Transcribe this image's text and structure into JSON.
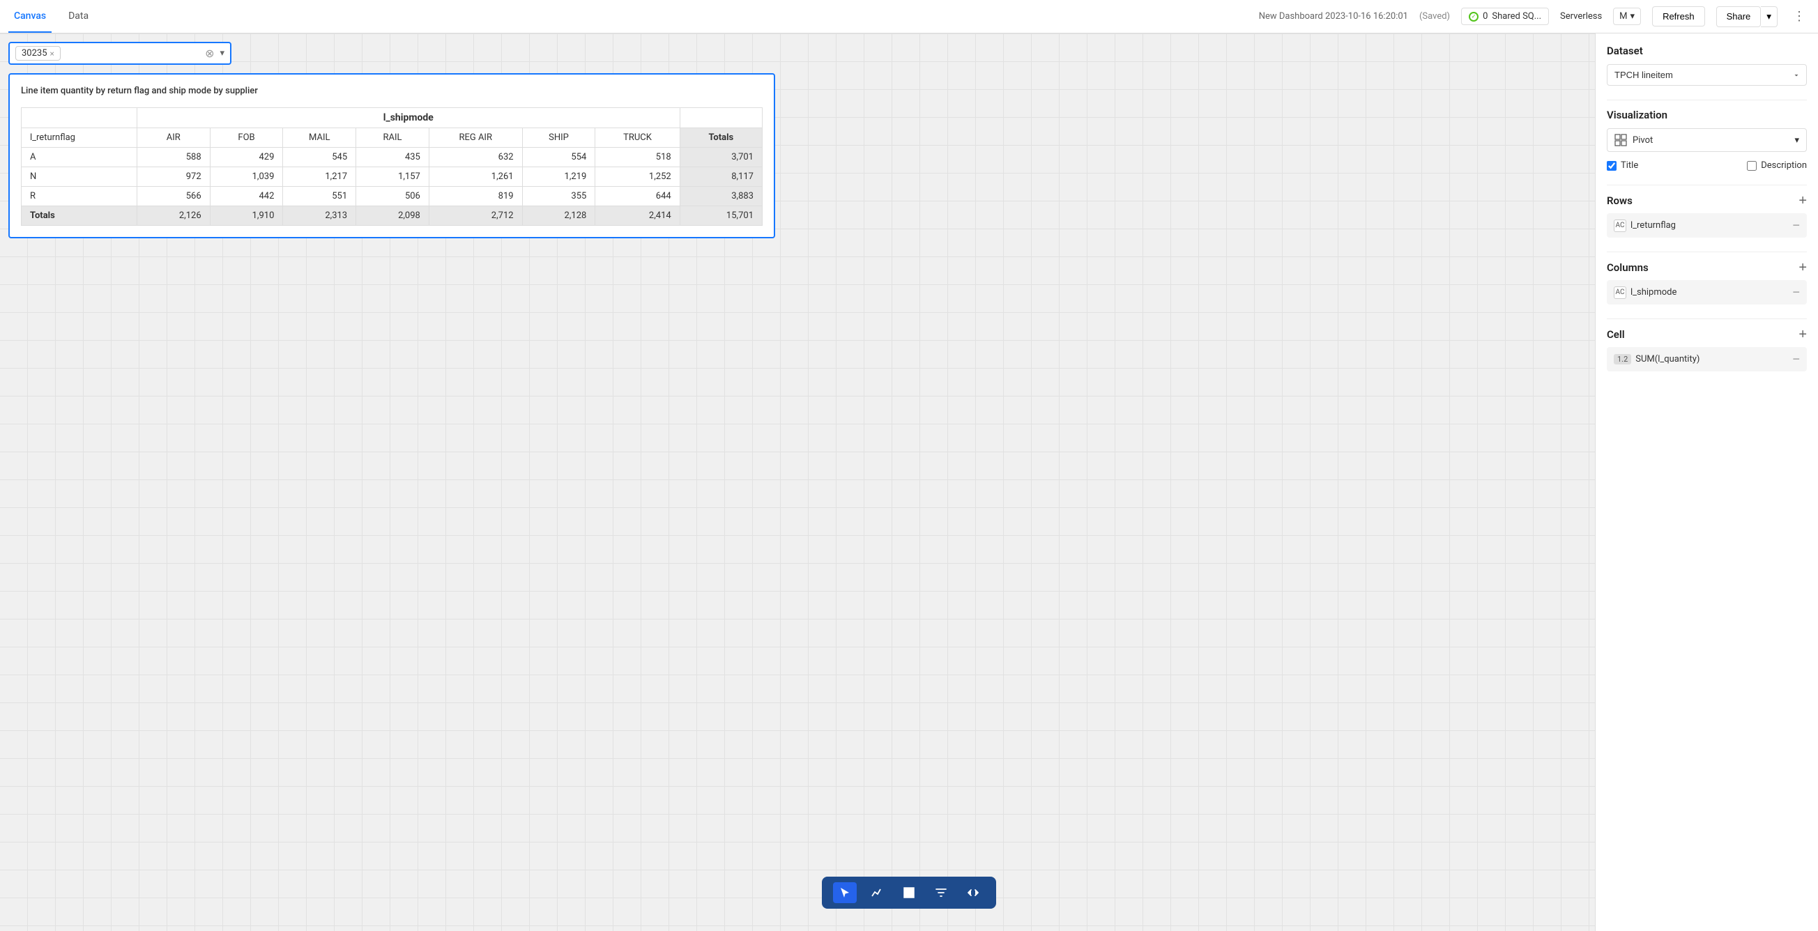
{
  "header": {
    "tabs": [
      {
        "label": "Canvas",
        "active": true
      },
      {
        "label": "Data",
        "active": false
      }
    ],
    "dashboard_title": "New Dashboard 2023-10-16 16:20:01",
    "saved_label": "(Saved)",
    "status_count": "0",
    "status_name": "Shared SQ...",
    "serverless_label": "Serverless",
    "m_value": "M",
    "refresh_label": "Refresh",
    "share_label": "Share",
    "more_icon": "⋮"
  },
  "filter_bar": {
    "tag_value": "30235",
    "tag_close": "×",
    "clear_icon": "⊗",
    "arrow_icon": "▾"
  },
  "chart": {
    "title": "Line item quantity by return flag and ship mode by supplier",
    "col_header": "l_shipmode",
    "columns": [
      "l_returnflag",
      "AIR",
      "FOB",
      "MAIL",
      "RAIL",
      "REG AIR",
      "SHIP",
      "TRUCK",
      "Totals"
    ],
    "rows": [
      {
        "label": "A",
        "values": [
          588,
          429,
          545,
          435,
          632,
          554,
          518,
          3701
        ]
      },
      {
        "label": "N",
        "values": [
          972,
          1039,
          1217,
          1157,
          1261,
          1219,
          1252,
          8117
        ]
      },
      {
        "label": "R",
        "values": [
          566,
          442,
          551,
          506,
          819,
          355,
          644,
          3883
        ]
      }
    ],
    "totals_label": "Totals",
    "totals_values": [
      2126,
      1910,
      2313,
      2098,
      2712,
      2128,
      2414,
      15701
    ]
  },
  "toolbar": {
    "buttons": [
      {
        "name": "select-tool",
        "icon": "cursor"
      },
      {
        "name": "chart-tool",
        "icon": "chart"
      },
      {
        "name": "table-tool",
        "icon": "table"
      },
      {
        "name": "filter-tool",
        "icon": "filter"
      },
      {
        "name": "code-tool",
        "icon": "code"
      }
    ]
  },
  "right_panel": {
    "dataset_label": "Dataset",
    "dataset_value": "TPCH lineitem",
    "visualization_label": "Visualization",
    "viz_type": "Pivot",
    "title_label": "Title",
    "description_label": "Description",
    "title_checked": true,
    "description_checked": false,
    "rows_label": "Rows",
    "rows_items": [
      {
        "label": "l_returnflag",
        "type": "AC"
      }
    ],
    "columns_label": "Columns",
    "columns_items": [
      {
        "label": "l_shipmode",
        "type": "AC"
      }
    ],
    "cell_label": "Cell",
    "cell_items": [
      {
        "badge": "1.2",
        "label": "SUM(l_quantity)"
      }
    ]
  }
}
